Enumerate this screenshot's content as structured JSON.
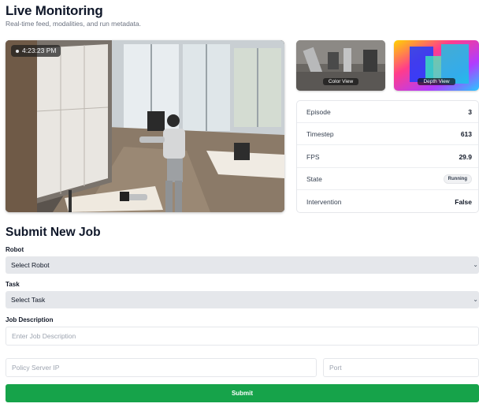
{
  "header": {
    "title": "Live Monitoring",
    "subtitle": "Real-time feed, modalities, and run metadata."
  },
  "feed": {
    "timestamp": "4:23:23 PM"
  },
  "thumbnails": {
    "color_label": "Color View",
    "depth_label": "Depth View"
  },
  "stats": [
    {
      "label": "Episode",
      "value": "3"
    },
    {
      "label": "Timestep",
      "value": "613"
    },
    {
      "label": "FPS",
      "value": "29.9"
    },
    {
      "label": "State",
      "value": "Running"
    },
    {
      "label": "Intervention",
      "value": "False"
    }
  ],
  "form": {
    "title": "Submit New Job",
    "robot_label": "Robot",
    "robot_value": "Select Robot",
    "task_label": "Task",
    "task_value": "Select Task",
    "description_label": "Job Description",
    "description_placeholder": "Enter Job Description",
    "policy_ip_placeholder": "Policy Server IP",
    "port_placeholder": "Port",
    "submit_label": "Submit"
  },
  "colors": {
    "accent": "#16a34a",
    "select_bg": "#e5e7eb",
    "title": "#0f1729"
  }
}
